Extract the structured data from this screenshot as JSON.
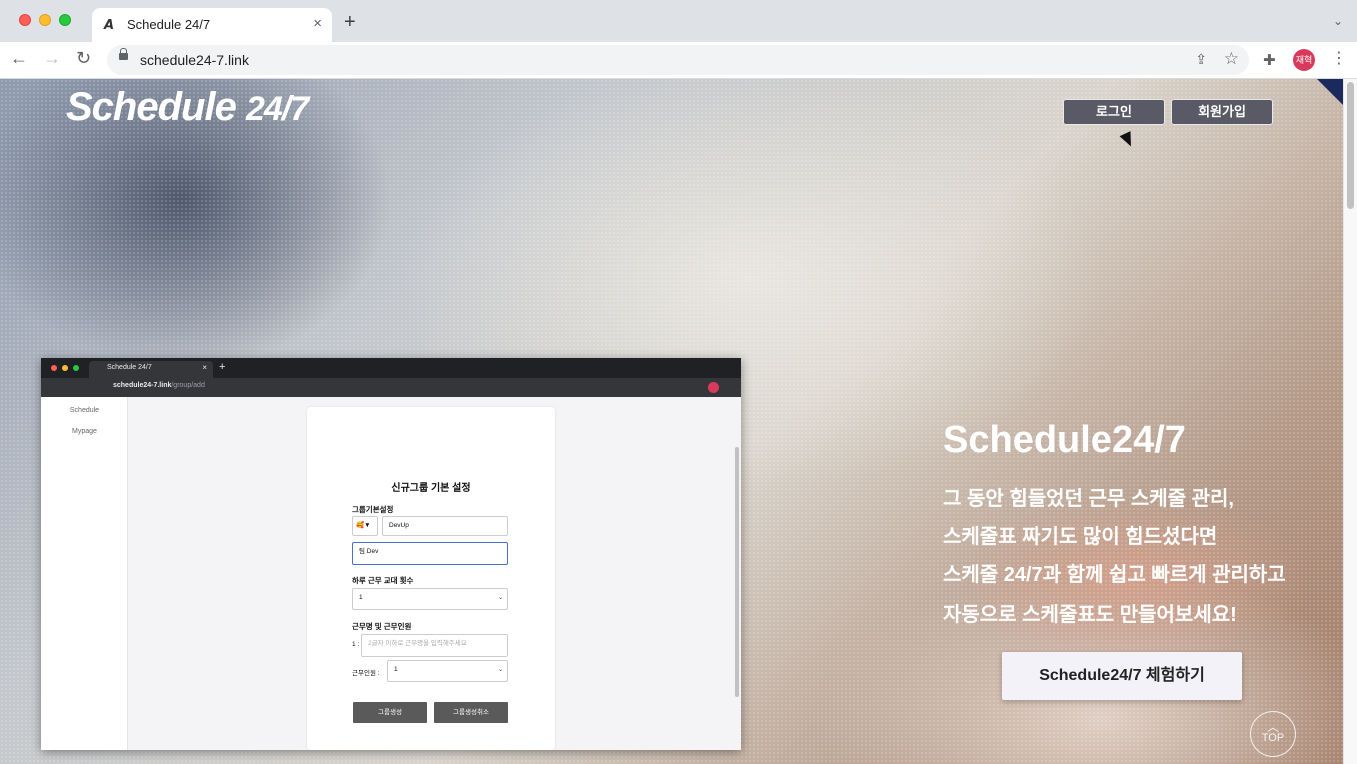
{
  "browser": {
    "tab_title": "Schedule 24/7",
    "tab_close": "×",
    "new_tab": "+",
    "tab_menu": "⌄",
    "url": "schedule24-7.link",
    "avatar_text": "재혁",
    "nav_back": "←",
    "nav_forward": "→",
    "nav_reload": "↻",
    "share_icon": "⇪",
    "star_icon": "☆",
    "extensions_icon": "✚",
    "menu_icon": "⋮"
  },
  "header": {
    "logo_main": "Schedule ",
    "logo_suffix": "24/7",
    "login_label": "로그인",
    "signup_label": "회원가입"
  },
  "hero": {
    "title": "Schedule24/7",
    "line1": "그 동안 힘들었던 근무 스케줄 관리,",
    "line2": "스케줄표 짜기도 많이 힘드셨다면",
    "line3": "스케줄 24/7과 함께 쉽고 빠르게 관리하고",
    "line4": "자동으로 스케줄표도 만들어보세요!",
    "cta_label": "Schedule24/7 체험하기"
  },
  "top_button": {
    "chevron": "︿",
    "label": "TOP"
  },
  "demo": {
    "tab_title": "Schedule 24/7",
    "tab_close": "×",
    "new_tab": "+",
    "url_host": "schedule24-7.link",
    "url_path": "/group/add",
    "sidebar_items": [
      "Schedule",
      "Mypage"
    ],
    "form_title": "신규그룹 기본 설정",
    "section_basic": "그룹기본설정",
    "emoji_select": "🥰▼",
    "group_name_value": "DevUp",
    "description_value": "팀 Dev",
    "section_shifts": "하루 근무 교대 횟수",
    "shifts_value": "1",
    "section_shift_names": "근무명 및 근무인원",
    "shift_prefix": "1 :",
    "shift_name_placeholder": "2글자 이하로 근무명을 입력해주세요",
    "headcount_label": "근무인원 :",
    "headcount_value": "1",
    "create_button": "그룹생성",
    "cancel_button": "그룹생성취소",
    "caret": "⌄"
  }
}
